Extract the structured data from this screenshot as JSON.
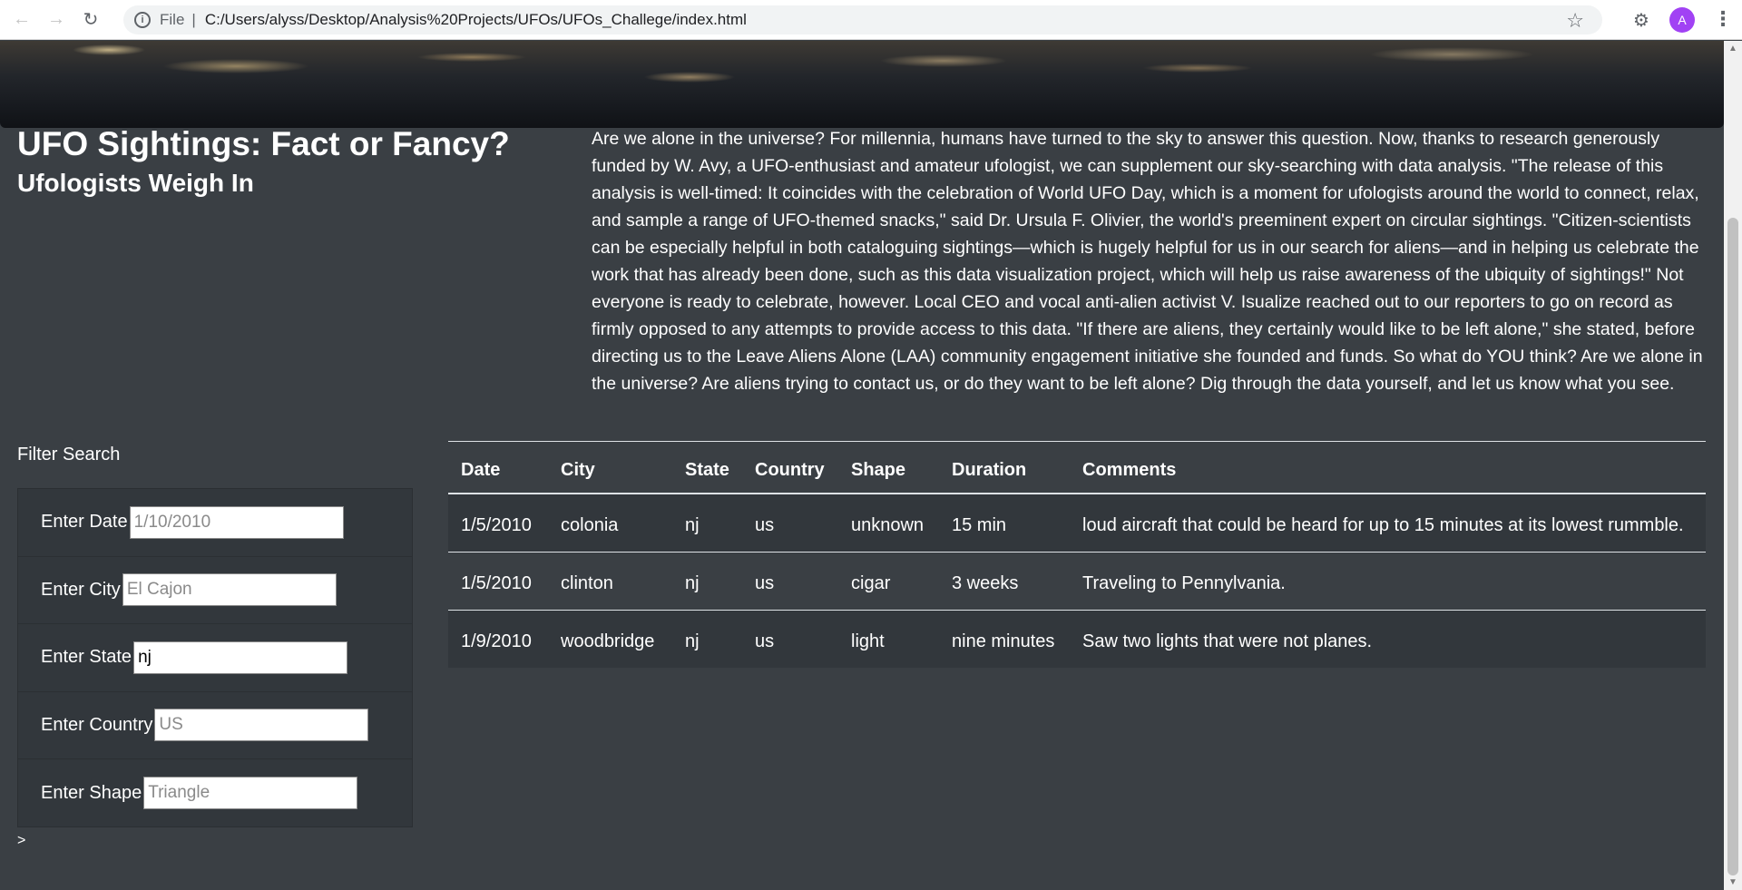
{
  "browser": {
    "scheme": "File",
    "url": "C:/Users/alyss/Desktop/Analysis%20Projects/UFOs/UFOs_Challege/index.html",
    "avatar_letter": "A"
  },
  "header": {
    "title": "UFO Sightings: Fact or Fancy?",
    "subtitle": "Ufologists Weigh In"
  },
  "article": {
    "text": "Are we alone in the universe? For millennia, humans have turned to the sky to answer this question. Now, thanks to research generously funded by W. Avy, a UFO-enthusiast and amateur ufologist, we can supplement our sky-searching with data analysis. \"The release of this analysis is well-timed: It coincides with the celebration of World UFO Day, which is a moment for ufologists around the world to connect, relax, and sample a range of UFO-themed snacks,\" said Dr. Ursula F. Olivier, the world's preeminent expert on circular sightings. \"Citizen-scientists can be especially helpful in both cataloguing sightings—which is hugely helpful for us in our search for aliens—and in helping us celebrate the work that has already been done, such as this data visualization project, which will help us raise awareness of the ubiquity of sightings!\" Not everyone is ready to celebrate, however. Local CEO and vocal anti-alien activist V. Isualize reached out to our reporters to go on record as firmly opposed to any attempts to provide access to this data. \"If there are aliens, they certainly would like to be left alone,\" she stated, before directing us to the Leave Aliens Alone (LAA) community engagement initiative she founded and funds. So what do YOU think? Are we alone in the universe? Are aliens trying to contact us, or do they want to be left alone? Dig through the data yourself, and let us know what you see."
  },
  "filters": {
    "heading": "Filter Search",
    "date": {
      "label": "Enter Date",
      "placeholder": "1/10/2010",
      "value": ""
    },
    "city": {
      "label": "Enter City",
      "placeholder": "El Cajon",
      "value": ""
    },
    "state": {
      "label": "Enter State",
      "placeholder": "",
      "value": "nj"
    },
    "country": {
      "label": "Enter Country",
      "placeholder": "US",
      "value": ""
    },
    "shape": {
      "label": "Enter Shape",
      "placeholder": "Triangle",
      "value": ""
    }
  },
  "footer_prompt": ">",
  "table": {
    "headers": [
      "Date",
      "City",
      "State",
      "Country",
      "Shape",
      "Duration",
      "Comments"
    ],
    "rows": [
      [
        "1/5/2010",
        "colonia",
        "nj",
        "us",
        "unknown",
        "15 min",
        "loud aircraft that could be heard for up to 15 minutes at its lowest rummble."
      ],
      [
        "1/5/2010",
        "clinton",
        "nj",
        "us",
        "cigar",
        "3 weeks",
        "Traveling to Pennylvania."
      ],
      [
        "1/9/2010",
        "woodbridge",
        "nj",
        "us",
        "light",
        "nine minutes",
        "Saw two lights that were not planes."
      ]
    ]
  }
}
